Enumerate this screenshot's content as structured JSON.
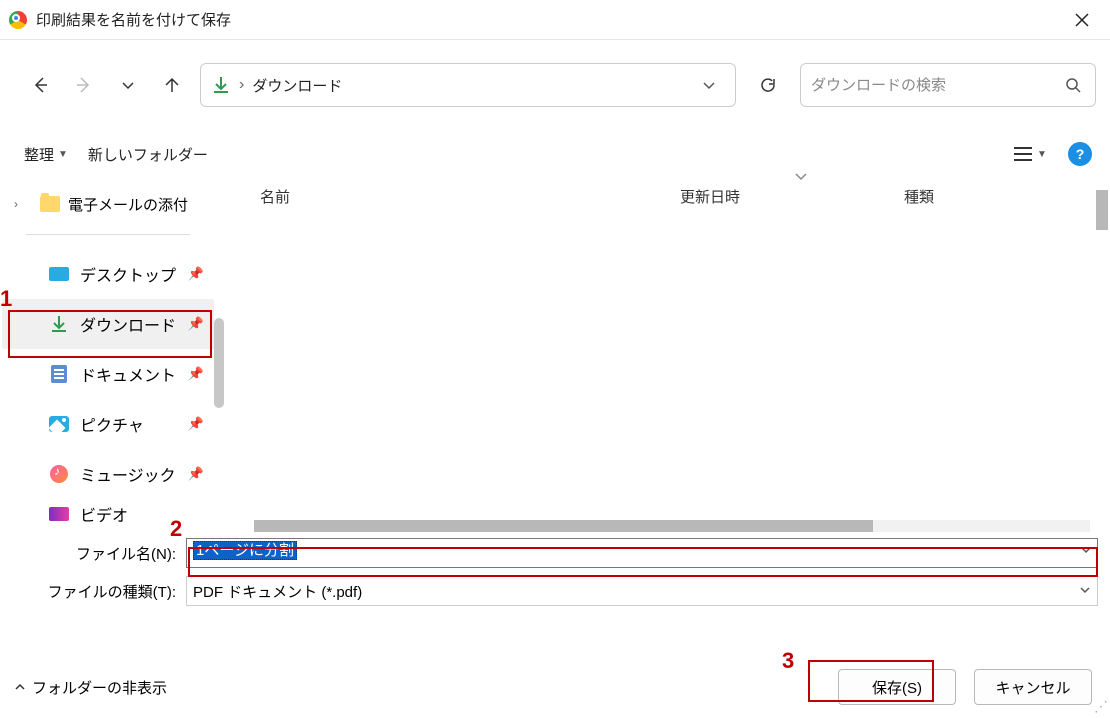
{
  "title": "印刷結果を名前を付けて保存",
  "breadcrumb_separator": "›",
  "current_folder": "ダウンロード",
  "search_placeholder": "ダウンロードの検索",
  "toolbar": {
    "organize": "整理",
    "new_folder": "新しいフォルダー"
  },
  "sidebar": {
    "email_folder": "電子メールの添付",
    "places": [
      {
        "label": "デスクトップ",
        "icon": "desktop"
      },
      {
        "label": "ダウンロード",
        "icon": "download",
        "active": true
      },
      {
        "label": "ドキュメント",
        "icon": "document"
      },
      {
        "label": "ピクチャ",
        "icon": "picture"
      },
      {
        "label": "ミュージック",
        "icon": "music"
      },
      {
        "label": "ビデオ",
        "icon": "video"
      }
    ]
  },
  "columns": {
    "name": "名前",
    "modified": "更新日時",
    "type": "種類"
  },
  "filename_label": "ファイル名(N):",
  "filetype_label": "ファイルの種類(T):",
  "filename_value": "1ページに分割",
  "filetype_value": "PDF ドキュメント (*.pdf)",
  "footer": {
    "hide_folders": "フォルダーの非表示",
    "save": "保存(S)",
    "cancel": "キャンセル"
  },
  "annotations": {
    "n1": "1",
    "n2": "2",
    "n3": "3"
  }
}
